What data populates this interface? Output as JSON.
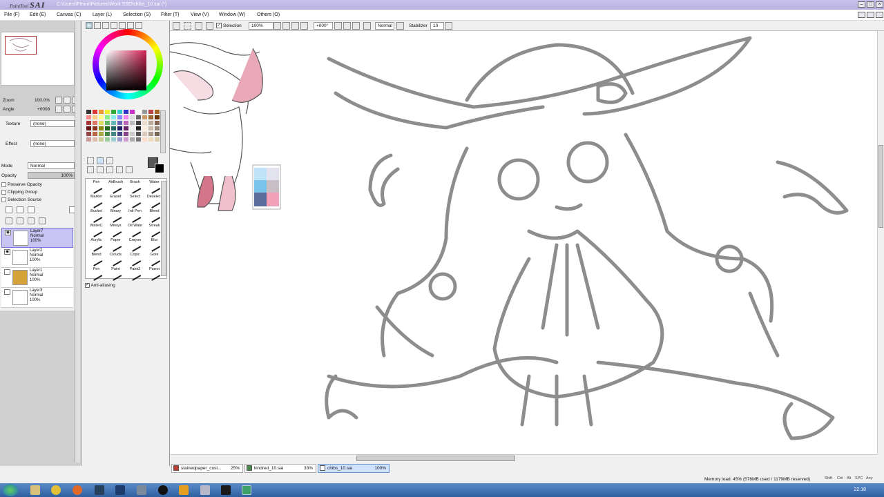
{
  "app": {
    "logo_small": "PaintTool",
    "logo_big": "SAI",
    "title": "C:\\Users\\Fenrn\\Pictures\\Work SSD\\chibs_10.sai (*)"
  },
  "menu": [
    "File (F)",
    "Edit (E)",
    "Canvas (C)",
    "Layer (L)",
    "Selection (S)",
    "Filter (T)",
    "View (V)",
    "Window (W)",
    "Others (O)"
  ],
  "navigator": {
    "zoom_label": "Zoom",
    "zoom_value": "100.0%",
    "angle_label": "Angle",
    "angle_value": "+0008"
  },
  "layer_props": {
    "texture_label": "Texture",
    "texture_value": "(none)",
    "effect_label": "Effect",
    "effect_value": "(none)",
    "mode_label": "Mode",
    "mode_value": "Normal",
    "opacity_label": "Opacity",
    "opacity_value": "100%",
    "preserve_opacity": "Preserve Opacity",
    "clipping_group": "Clipping Group",
    "selection_source": "Selection Source"
  },
  "layers": [
    {
      "name": "Layer7",
      "mode": "Normal",
      "opacity": "100%",
      "selected": true,
      "fill": "#ffffff"
    },
    {
      "name": "Layer2",
      "mode": "Normal",
      "opacity": "100%",
      "selected": false,
      "fill": "#ffffff"
    },
    {
      "name": "Layer1",
      "mode": "Normal",
      "opacity": "100%",
      "selected": false,
      "fill": "#d6a33a"
    },
    {
      "name": "Layer3",
      "mode": "Normal",
      "opacity": "100%",
      "selected": false,
      "fill": "#ffffff"
    }
  ],
  "tools": [
    [
      "Pen",
      "AirBrush",
      "Brush",
      "Water"
    ],
    [
      "Marker",
      "Eraser",
      "Select",
      "Deselect"
    ],
    [
      "Bucket",
      "Binary",
      "Ink Pen",
      "Blend"
    ],
    [
      "WaterC",
      "Mireys",
      "Oil Wate",
      "Streak"
    ],
    [
      "Acrylic",
      "Paper",
      "Crayon",
      "Blur"
    ],
    [
      "Blend",
      "Clouds",
      "Copic",
      "Gore"
    ],
    [
      "Pen",
      "Paint",
      "Paint2",
      "Parrot"
    ]
  ],
  "anti_aliasing": "Anti-aliasing",
  "toolbar": {
    "selection_label": "Selection",
    "zoom": "100%",
    "angle": "+000°",
    "blend": "Normal",
    "stabilizer_label": "Stabilizer",
    "stabilizer_value": "10"
  },
  "files": [
    {
      "name": "stainedpaper_cust...",
      "zoom": "25%",
      "active": false
    },
    {
      "name": "kindred_10.sai",
      "zoom": "33%",
      "active": false
    },
    {
      "name": "chibs_10.sai",
      "zoom": "100%",
      "active": true
    }
  ],
  "status": {
    "memory": "Memory load: 45% (578MB used / 1179MB reserved)",
    "keys": [
      "Shift",
      "Ctrl",
      "Alt",
      "SPC",
      "Any"
    ]
  },
  "clock": "22:18",
  "colors": {
    "accent": "#c7c3f3",
    "primary_color": "#575757",
    "secondary_color": "#000000"
  }
}
